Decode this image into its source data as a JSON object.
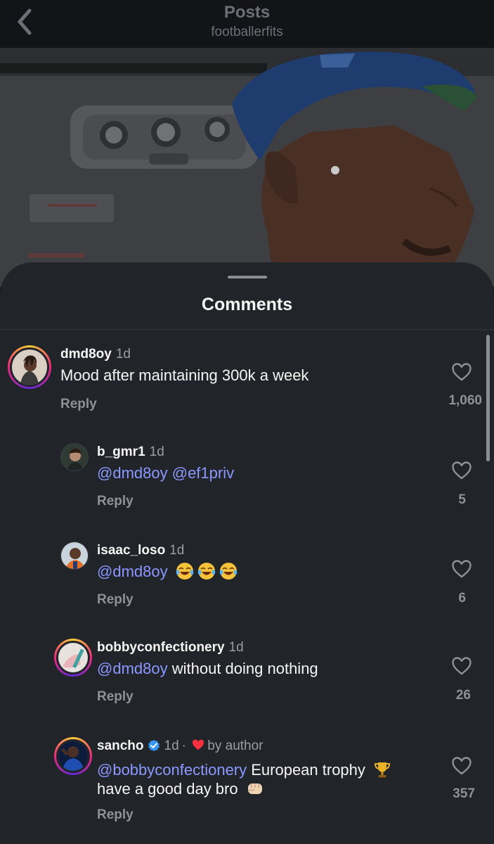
{
  "nav": {
    "title": "Posts",
    "subtitle": "footballerfits",
    "back_icon": "chevron-left-icon"
  },
  "sheet": {
    "title": "Comments"
  },
  "comments": [
    {
      "username": "dmd8oy",
      "time": "1d",
      "text": "Mood after maintaining 300k a week",
      "reply_label": "Reply",
      "likes": "1,060"
    },
    {
      "username": "b_gmr1",
      "time": "1d",
      "mention1": "@dmd8oy",
      "mention2": "@ef1priv",
      "reply_label": "Reply",
      "likes": "5"
    },
    {
      "username": "isaac_loso",
      "time": "1d",
      "mention": "@dmd8oy",
      "emoji": "face-with-tears-of-joy-icon",
      "reply_label": "Reply",
      "likes": "6"
    },
    {
      "username": "bobbyconfectionery",
      "time": "1d",
      "mention": "@dmd8oy",
      "text": " without doing nothing",
      "reply_label": "Reply",
      "likes": "26"
    },
    {
      "username": "sancho",
      "time": "1d",
      "dot": "·",
      "by_author": "by author",
      "mention": "@bobbyconfectionery",
      "text_line1": " European trophy",
      "text_line2": "have a good day bro",
      "reply_label": "Reply",
      "likes": "357"
    }
  ],
  "colors": {
    "sheet_bg": "#212428",
    "mention": "#8a98ff",
    "secondary_text": "#8e9196",
    "heart_red": "#ff3040",
    "verified_blue": "#3897f0"
  }
}
